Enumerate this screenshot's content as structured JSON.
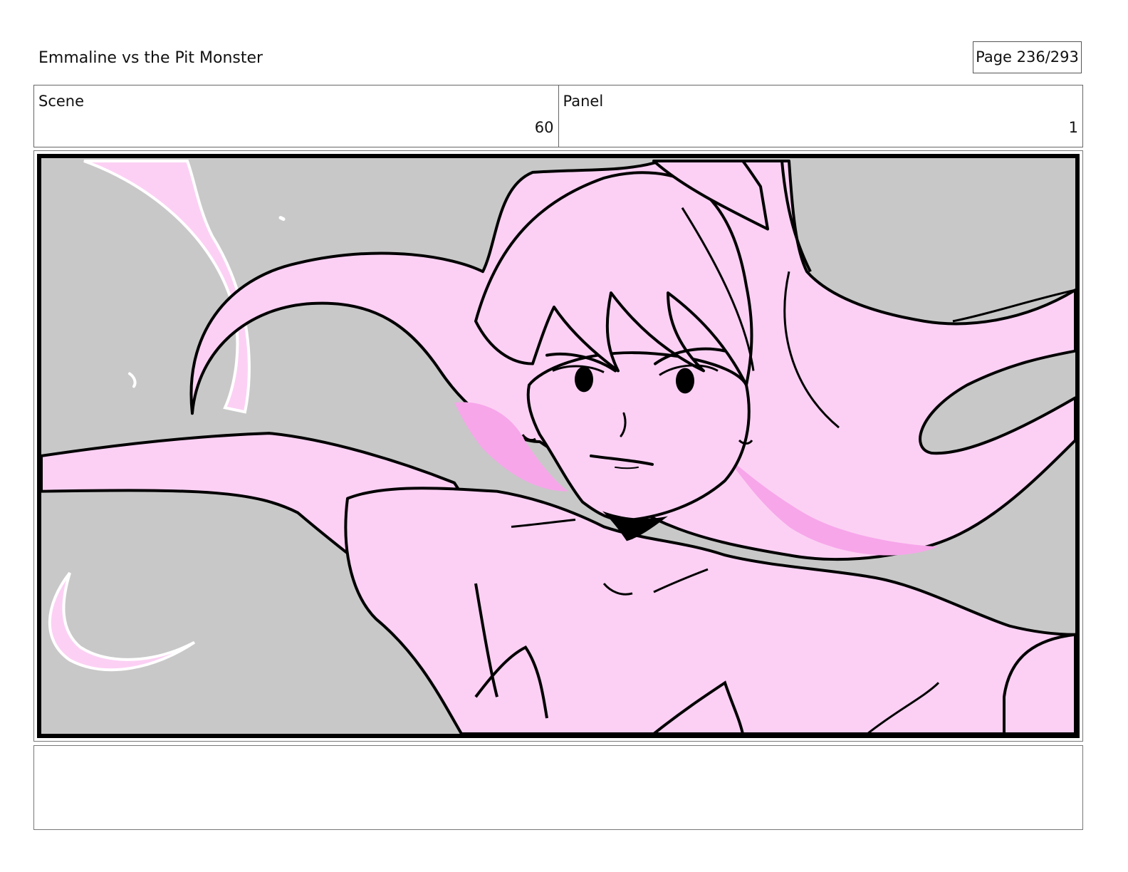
{
  "header": {
    "title": "Emmaline vs the Pit Monster",
    "page_indicator": "Page 236/293"
  },
  "panel_info": {
    "scene_label": "Scene",
    "scene_value": "60",
    "panel_label": "Panel",
    "panel_value": "1"
  },
  "artwork": {
    "background_color": "#c8c8c8",
    "skin_color": "#fcd0f4",
    "shadow_color": "#f7a6ea",
    "line_color": "#000000"
  },
  "notes": {
    "text": ""
  }
}
